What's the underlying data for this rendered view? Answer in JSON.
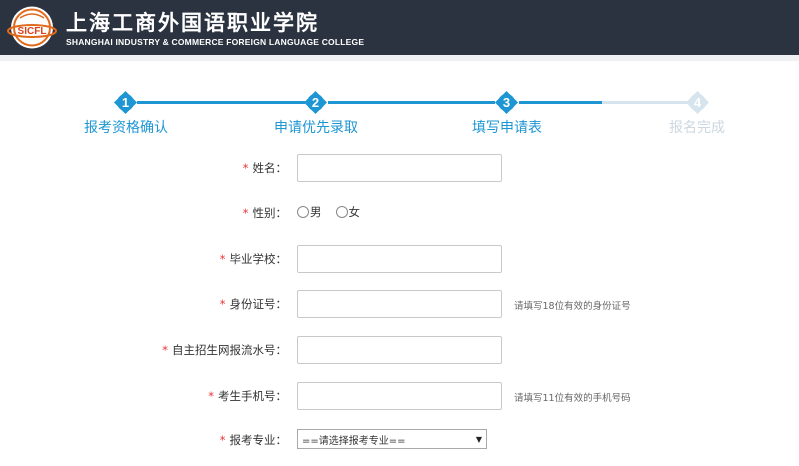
{
  "header": {
    "logo_cn": "上海工商外国语职业学院",
    "logo_en": "SHANGHAI INDUSTRY & COMMERCE FOREIGN LANGUAGE COLLEGE",
    "badge_text": "SICFL",
    "bg_color": "#2b3240"
  },
  "steps": {
    "items": [
      {
        "num": "1",
        "label": "报考资格确认",
        "state": "done"
      },
      {
        "num": "2",
        "label": "申请优先录取",
        "state": "done"
      },
      {
        "num": "3",
        "label": "填写申请表",
        "state": "current"
      },
      {
        "num": "4",
        "label": "报名完成",
        "state": "pending"
      }
    ],
    "active_color": "#1e96d3",
    "inactive_color": "#d6e4ee"
  },
  "form": {
    "required_mark": "*",
    "name": {
      "label": "姓名：",
      "value": ""
    },
    "gender": {
      "label": "性别：",
      "options": [
        "男",
        "女"
      ]
    },
    "school": {
      "label": "毕业学校：",
      "value": ""
    },
    "id_number": {
      "label": "身份证号：",
      "value": "",
      "hint": "请填写18位有效的身份证号"
    },
    "serial": {
      "label": "自主招生网报流水号：",
      "value": ""
    },
    "phone": {
      "label": "考生手机号：",
      "value": "",
      "hint": "请填写11位有效的手机号码"
    },
    "major": {
      "label": "报考专业：",
      "selected": "==请选择报考专业=="
    }
  }
}
